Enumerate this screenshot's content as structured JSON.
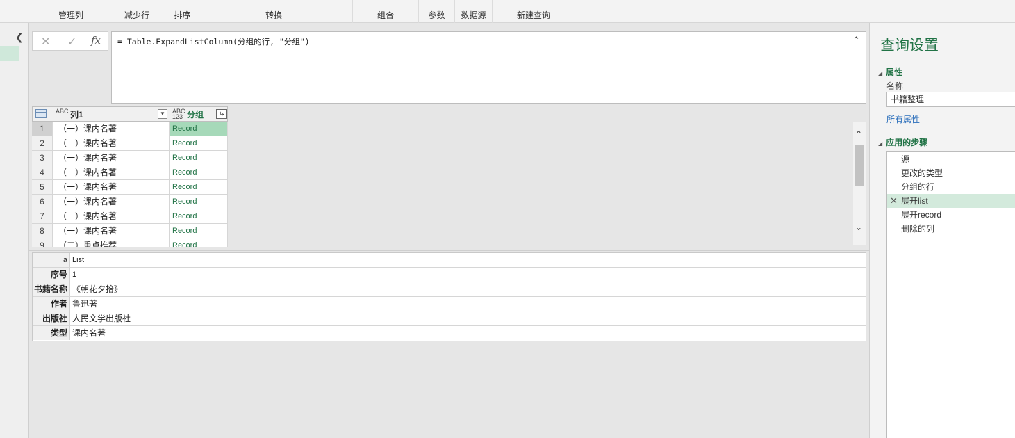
{
  "ribbon": {
    "groups": [
      {
        "label": "管理列"
      },
      {
        "label": "减少行"
      },
      {
        "label": "排序"
      },
      {
        "label": "转换"
      },
      {
        "label": "组合"
      },
      {
        "label": "参数"
      },
      {
        "label": "数据源"
      },
      {
        "label": "新建查询"
      }
    ]
  },
  "formula": {
    "cancel_icon": "✕",
    "commit_icon": "✓",
    "fx_label": "fx",
    "text": "= Table.ExpandListColumn(分组的行, \"分组\")"
  },
  "grid": {
    "columns": [
      {
        "type": "ABC",
        "name": "列1"
      },
      {
        "type": "ABC 123",
        "name": "分组"
      }
    ],
    "rows": [
      {
        "num": "1",
        "col1": "（一）课内名著",
        "col2": "Record"
      },
      {
        "num": "2",
        "col1": "（一）课内名著",
        "col2": "Record"
      },
      {
        "num": "3",
        "col1": "（一）课内名著",
        "col2": "Record"
      },
      {
        "num": "4",
        "col1": "（一）课内名著",
        "col2": "Record"
      },
      {
        "num": "5",
        "col1": "（一）课内名著",
        "col2": "Record"
      },
      {
        "num": "6",
        "col1": "（一）课内名著",
        "col2": "Record"
      },
      {
        "num": "7",
        "col1": "（一）课内名著",
        "col2": "Record"
      },
      {
        "num": "8",
        "col1": "（一）课内名著",
        "col2": "Record"
      },
      {
        "num": "9",
        "col1": "（二）重点推荐",
        "col2": "Record"
      }
    ]
  },
  "detail": {
    "rows": [
      {
        "key": "a",
        "value": "List"
      },
      {
        "key": "序号",
        "value": "1"
      },
      {
        "key": "书籍名称",
        "value": "《朝花夕拾》"
      },
      {
        "key": "作者",
        "value": "鲁迅著"
      },
      {
        "key": "出版社",
        "value": "人民文学出版社"
      },
      {
        "key": "类型",
        "value": "课内名著"
      }
    ]
  },
  "settings": {
    "title": "查询设置",
    "properties_header": "属性",
    "name_label": "名称",
    "name_value": "书籍整理",
    "all_properties_link": "所有属性",
    "steps_header": "应用的步骤",
    "steps": [
      {
        "label": "源"
      },
      {
        "label": "更改的类型"
      },
      {
        "label": "分组的行"
      },
      {
        "label": "展开list"
      },
      {
        "label": "展开record"
      },
      {
        "label": "删除的列"
      }
    ]
  }
}
